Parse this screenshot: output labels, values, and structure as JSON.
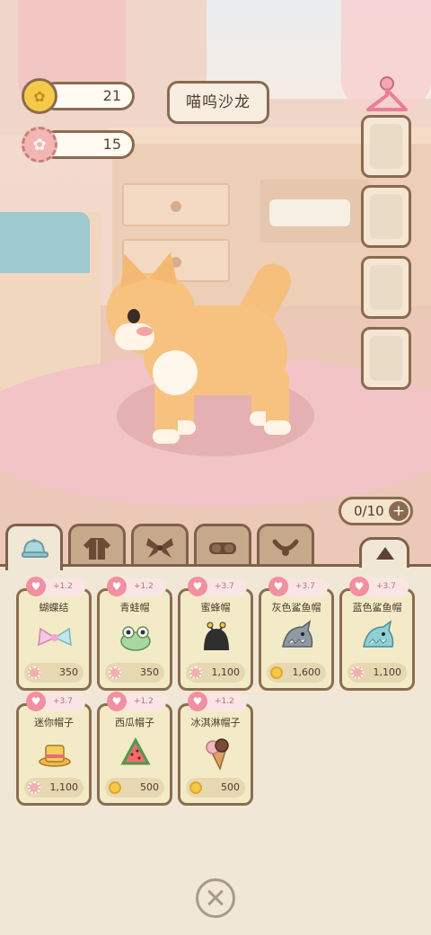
{
  "hud": {
    "coins": "21",
    "flowers": "15",
    "title": "喵呜沙龙",
    "outfit_count": "0/10",
    "add_symbol": "+"
  },
  "tabs": [
    {
      "id": "hats",
      "icon": "cap-icon",
      "active": true
    },
    {
      "id": "clothes",
      "icon": "jacket-icon",
      "active": false
    },
    {
      "id": "bows",
      "icon": "bow-icon",
      "active": false
    },
    {
      "id": "glasses",
      "icon": "goggles-icon",
      "active": false
    },
    {
      "id": "collars",
      "icon": "collar-icon",
      "active": false
    }
  ],
  "items": [
    {
      "name": "蝴蝶结",
      "bonus": "+1.2",
      "currency": "flower",
      "price": "350",
      "icon": "ribbon-bow-icon"
    },
    {
      "name": "青蛙帽",
      "bonus": "+1.2",
      "currency": "flower",
      "price": "350",
      "icon": "frog-hat-icon"
    },
    {
      "name": "蜜蜂帽",
      "bonus": "+3.7",
      "currency": "flower",
      "price": "1,100",
      "icon": "bee-hat-icon"
    },
    {
      "name": "灰色鲨鱼帽",
      "bonus": "+3.7",
      "currency": "coin",
      "price": "1,600",
      "icon": "grey-shark-hat-icon"
    },
    {
      "name": "蓝色鲨鱼帽",
      "bonus": "+3.7",
      "currency": "flower",
      "price": "1,100",
      "icon": "blue-shark-hat-icon"
    },
    {
      "name": "迷你帽子",
      "bonus": "+3.7",
      "currency": "flower",
      "price": "1,100",
      "icon": "mini-top-hat-icon"
    },
    {
      "name": "西瓜帽子",
      "bonus": "+1.2",
      "currency": "coin",
      "price": "500",
      "icon": "watermelon-hat-icon"
    },
    {
      "name": "冰淇淋帽子",
      "bonus": "+1.2",
      "currency": "coin",
      "price": "500",
      "icon": "ice-cream-hat-icon"
    }
  ],
  "colors": {
    "panel": "#f1e7d6",
    "card": "#f3ebc7",
    "border": "#8b6e4f",
    "heart": "#f28fa0"
  }
}
